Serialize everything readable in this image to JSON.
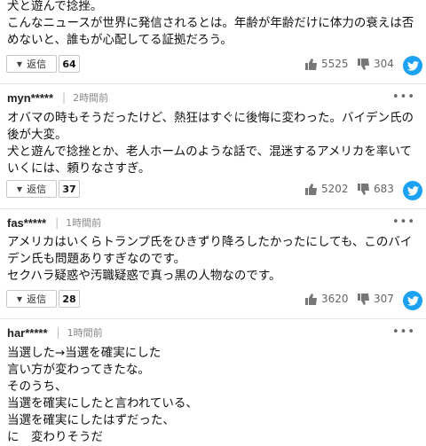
{
  "comments": [
    {
      "body": "犬と遊んで捻挫。\nこんなニュースが世界に発信されるとは。年齢が年齢だけに体力の衰えは否めないと、誰もが心配してる証拠だろう。",
      "reply_label": "返信",
      "reply_count": "64",
      "likes": "5525",
      "dislikes": "304"
    },
    {
      "user": "myn*****",
      "time": "2時間前",
      "body": "オバマの時もそうだったけど、熱狂はすぐに後悔に変わった。バイデン氏の後が大変。\n犬と遊んで捻挫とか、老人ホームのような話で、混迷するアメリカを率いていくには、頼りなさすぎ。",
      "reply_label": "返信",
      "reply_count": "37",
      "likes": "5202",
      "dislikes": "683"
    },
    {
      "user": "fas*****",
      "time": "1時間前",
      "body": "アメリカはいくらトランプ氏をひきずり降ろしたかったにしても、このバイデン氏も問題ありすぎなのです。\nセクハラ疑惑や汚職疑惑で真っ黒の人物なのです。",
      "reply_label": "返信",
      "reply_count": "28",
      "likes": "3620",
      "dislikes": "307"
    },
    {
      "user": "har*****",
      "time": "1時間前",
      "body": "当選した→当選を確実にした\n言い方が変わってきたな。\nそのうち、\n当選を確実にしたと言われている、\n当選を確実にしたはずだった、\nに　変わりそうだ"
    }
  ],
  "more_glyph": "•••",
  "colors": {
    "twitter": "#1da1f2",
    "border": "#c8c8c8",
    "muted": "#666666"
  },
  "icons": [
    "thumbs-up-icon",
    "thumbs-down-icon",
    "twitter-icon",
    "more-icon",
    "reply-triangle-icon"
  ]
}
